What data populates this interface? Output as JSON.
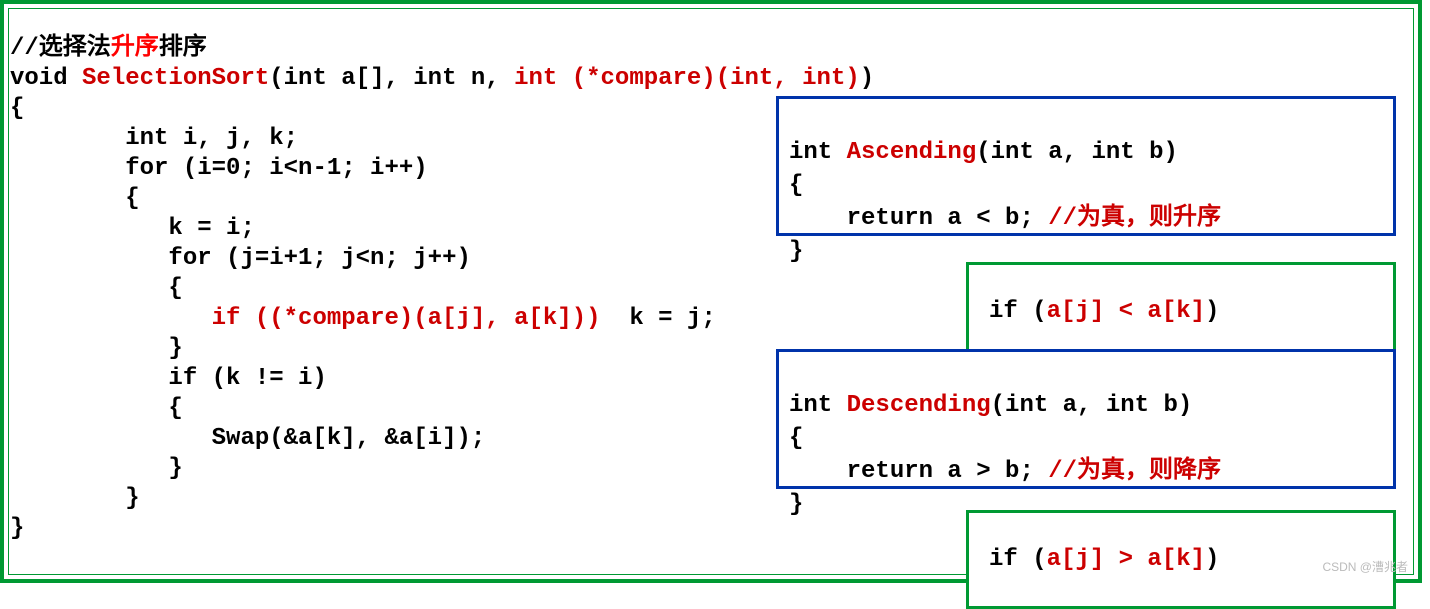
{
  "code": {
    "comment_pre": "//选择法",
    "comment_mid": "升序",
    "comment_post": "排序",
    "l1_a": "void ",
    "l1_fn": "SelectionSort",
    "l1_b": "(int a[], int n, ",
    "l1_fp": "int (*compare)(int, int)",
    "l1_c": ")",
    "l2": "{",
    "l3": "        int i, j, k;",
    "l4": "        for (i=0; i<n-1; i++)",
    "l5": "        {",
    "l6": "           k = i;",
    "l7": "           for (j=i+1; j<n; j++)",
    "l8": "           {",
    "l9_pad": "              ",
    "l9_if": "if ((*compare)(a[j], a[k]))",
    "l9_rest": "  k = j;",
    "l10": "           }",
    "l11": "           if (k != i)",
    "l12": "           {",
    "l13": "              Swap(&a[k], &a[i]);",
    "l14": "           }",
    "l15": "        }",
    "l16": "}"
  },
  "asc": {
    "l1_a": "int ",
    "l1_fn": "Ascending",
    "l1_b": "(int a, int b)",
    "l2": "{",
    "l3_a": "    return a < b;",
    "l3_c": " //为真，则升序",
    "l4": "}"
  },
  "desc": {
    "l1_a": "int ",
    "l1_fn": "Descending",
    "l1_b": "(int a, int b)",
    "l2": "{",
    "l3_a": "    return a > b;",
    "l3_c": " //为真，则降序",
    "l4": "}"
  },
  "cond1_a": "if (",
  "cond1_b": "a[j] < a[k]",
  "cond1_c": ")",
  "cond2_a": "if (",
  "cond2_b": "a[j] > a[k]",
  "cond2_c": ")",
  "watermark": "CSDN @漕兆者"
}
